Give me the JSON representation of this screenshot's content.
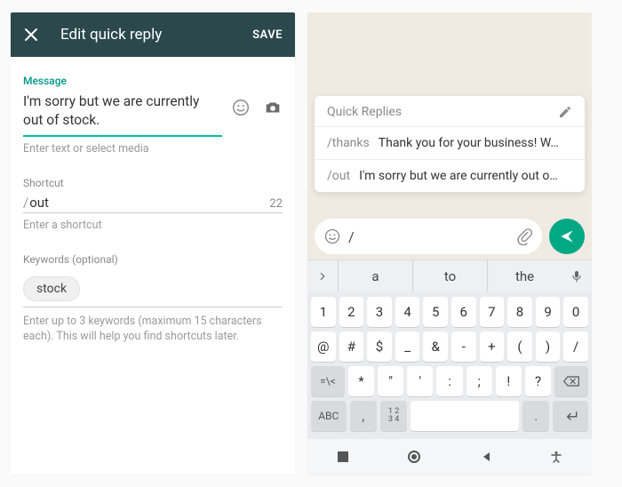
{
  "left": {
    "toolbar": {
      "title": "Edit quick reply",
      "save": "SAVE"
    },
    "message": {
      "label": "Message",
      "value": "I'm sorry but we are currently out of stock.",
      "helper": "Enter text or select media"
    },
    "shortcut": {
      "label": "Shortcut",
      "value": "out",
      "remaining": "22",
      "helper": "Enter a shortcut"
    },
    "keywords": {
      "label": "Keywords (optional)",
      "chip": "stock",
      "helper": "Enter up to 3 keywords (maximum 15 characters each). This will help you find shortcuts later."
    }
  },
  "right": {
    "card": {
      "title": "Quick Replies",
      "items": [
        {
          "cmd": "/thanks",
          "body": "Thank you for your business! W…"
        },
        {
          "cmd": "/out",
          "body": "I'm sorry but we are currently out o…"
        }
      ]
    },
    "compose": {
      "text": "/"
    },
    "suggestions": [
      "a",
      "to",
      "the"
    ],
    "keyboard": {
      "row1": [
        "1",
        "2",
        "3",
        "4",
        "5",
        "6",
        "7",
        "8",
        "9",
        "0"
      ],
      "row2": [
        "@",
        "#",
        "$",
        "_",
        "&",
        "-",
        "+",
        "(",
        ")",
        "/"
      ],
      "row3_shift": "=\\<",
      "row3": [
        "*",
        "\"",
        "'",
        ":",
        ";",
        "!",
        "?"
      ],
      "row4_mode": "ABC",
      "row4_comma": ",",
      "row4_numpad": "1 2\n3 4",
      "row4_dot": "."
    }
  }
}
